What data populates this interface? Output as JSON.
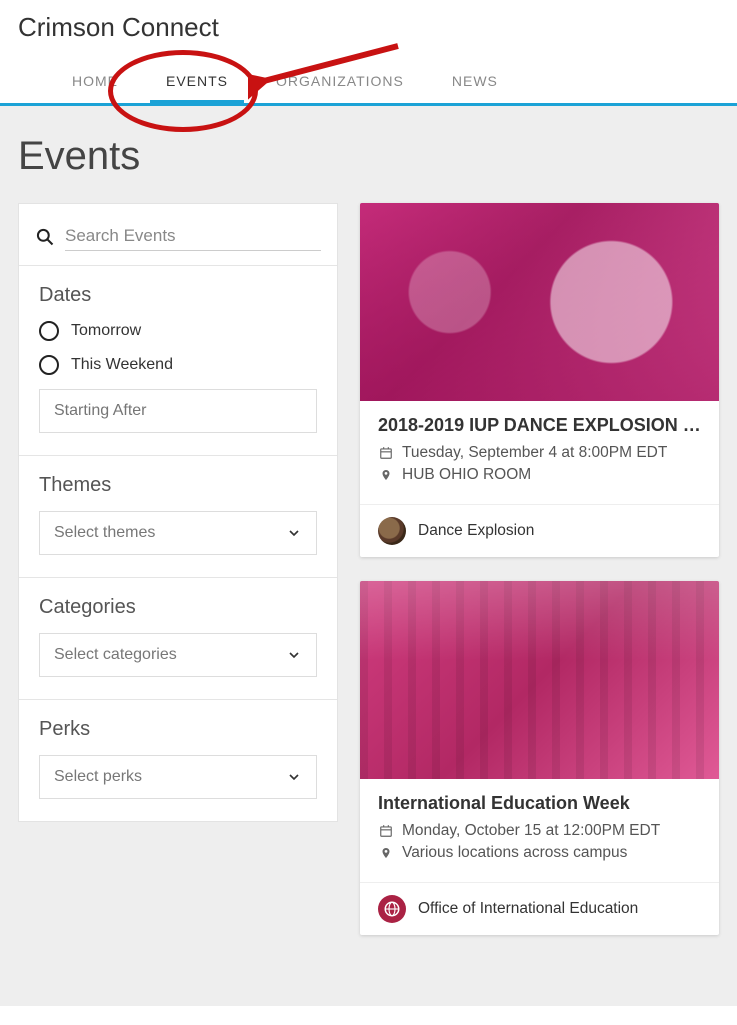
{
  "brand": "Crimson Connect",
  "nav": {
    "items": [
      {
        "label": "HOME"
      },
      {
        "label": "EVENTS",
        "active": true
      },
      {
        "label": "ORGANIZATIONS"
      },
      {
        "label": "NEWS"
      }
    ]
  },
  "page_title": "Events",
  "search": {
    "placeholder": "Search Events"
  },
  "filters": {
    "dates": {
      "title": "Dates",
      "options": [
        {
          "label": "Tomorrow"
        },
        {
          "label": "This Weekend"
        }
      ],
      "starting_after_placeholder": "Starting After"
    },
    "themes": {
      "title": "Themes",
      "placeholder": "Select themes"
    },
    "categories": {
      "title": "Categories",
      "placeholder": "Select categories"
    },
    "perks": {
      "title": "Perks",
      "placeholder": "Select perks"
    }
  },
  "events": [
    {
      "title": "2018-2019 IUP DANCE EXPLOSION …",
      "datetime": "Tuesday, September 4 at 8:00PM EDT",
      "location": "HUB OHIO ROOM",
      "org": "Dance Explosion"
    },
    {
      "title": "International Education Week",
      "datetime": "Monday, October 15 at 12:00PM EDT",
      "location": "Various locations across campus",
      "org": "Office of International Education"
    }
  ]
}
